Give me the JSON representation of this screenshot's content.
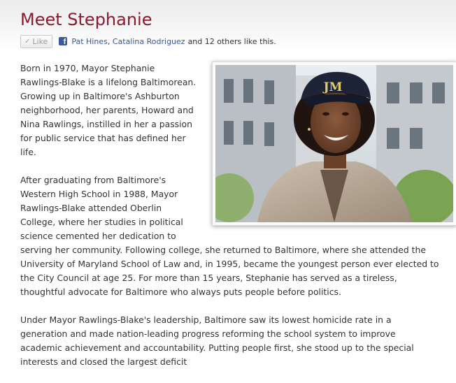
{
  "page": {
    "title": "Meet Stephanie"
  },
  "social": {
    "like_label": "Like",
    "friend_1": "Pat Hines",
    "separator": ",",
    "friend_2": "Catalina Rodriguez",
    "others_text": "and 12 others like this."
  },
  "photo": {
    "cap_text": "JM"
  },
  "body": {
    "paragraph_1": "Born in 1970, Mayor Stephanie Rawlings-Blake is a lifelong Baltimorean. Growing up in Baltimore's Ashburton neighborhood, her parents, Howard and Nina Rawlings, instilled in her a passion for public service that has defined her life.",
    "paragraph_2": "After graduating from Baltimore's Western High School in 1988, Mayor Rawlings-Blake attended Oberlin College, where her studies in political science cemented her dedication to serving her community. Following college, she returned to Baltimore, where she attended the University of Maryland School of Law and, in 1995, became the youngest person ever elected to the City Council at age 25. For more than 15 years, Stephanie has served as a tireless, thoughtful advocate for Baltimore who always puts people before politics.",
    "paragraph_3": "Under Mayor Rawlings-Blake's leadership, Baltimore saw its lowest homicide rate in a generation and made nation-leading progress reforming the school system to improve academic achievement and accountability. Putting people first, she stood up to the special interests and closed the largest deficit"
  },
  "colors": {
    "title": "#8b1a2e",
    "facebook_blue": "#3b5998",
    "body_text": "#333333"
  },
  "icons": {
    "like_check": "check-icon",
    "facebook": "facebook-icon"
  }
}
